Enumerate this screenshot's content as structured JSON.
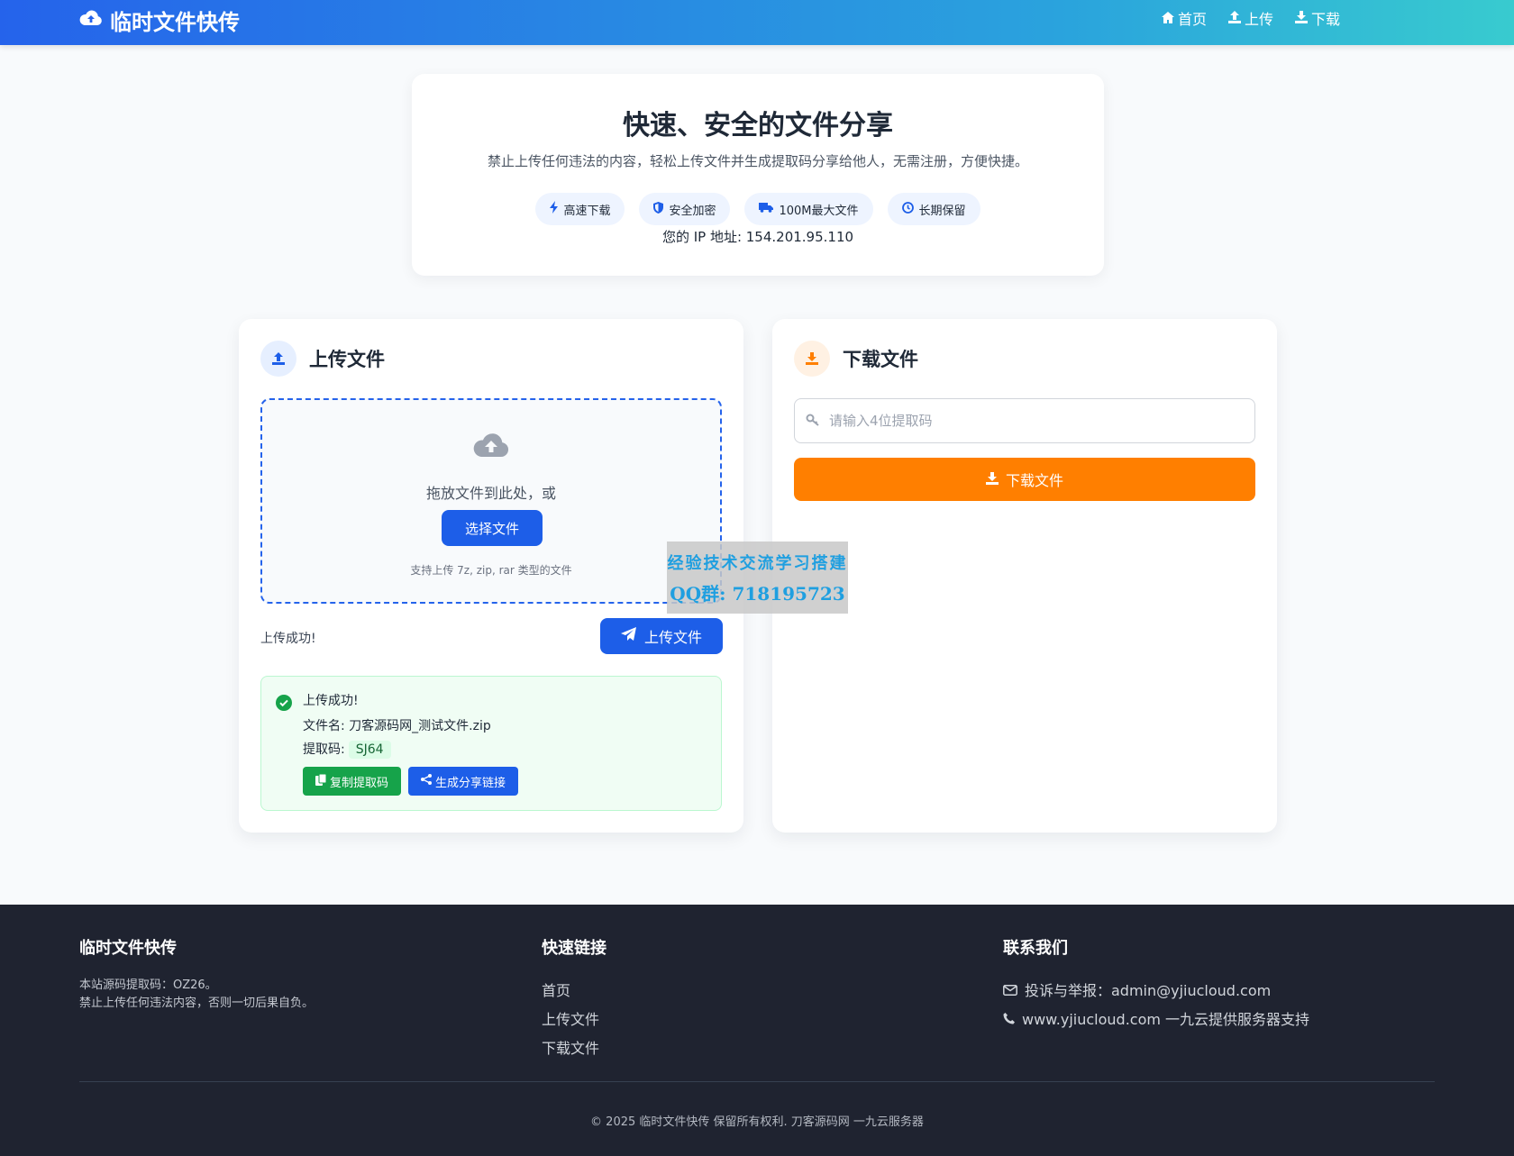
{
  "header": {
    "brand": "临时文件快传",
    "nav": [
      {
        "label": "首页",
        "icon": "home-icon"
      },
      {
        "label": "上传",
        "icon": "upload-icon"
      },
      {
        "label": "下载",
        "icon": "download-icon"
      }
    ]
  },
  "hero": {
    "title": "快速、安全的文件分享",
    "description": "禁止上传任何违法的内容，轻松上传文件并生成提取码分享给他人，无需注册，方便快捷。",
    "features": [
      {
        "label": "高速下载",
        "icon": "bolt-icon"
      },
      {
        "label": "安全加密",
        "icon": "shield-icon"
      },
      {
        "label": "100M最大文件",
        "icon": "truck-icon"
      },
      {
        "label": "长期保留",
        "icon": "clock-icon"
      }
    ],
    "ip_text": "您的 IP 地址: 154.201.95.110"
  },
  "upload": {
    "title": "上传文件",
    "drop_text": "拖放文件到此处，或",
    "choose_button": "选择文件",
    "hint": "支持上传 7z, zip, rar 类型的文件",
    "status": "上传成功!",
    "upload_button": "上传文件",
    "result": {
      "heading": "上传成功!",
      "filename_label": "文件名: 刀客源码网_测试文件.zip",
      "code_label": "提取码:",
      "code_value": "SJ64",
      "copy_button": "复制提取码",
      "share_button": "生成分享链接"
    }
  },
  "download": {
    "title": "下载文件",
    "input_placeholder": "请输入4位提取码",
    "input_value": "",
    "download_button": "下载文件"
  },
  "watermark": {
    "line1": "经验技术交流学习搭建",
    "line2": "QQ群: 718195723"
  },
  "footer": {
    "col1": {
      "heading": "临时文件快传",
      "line1": "本站源码提取码：OZ26。",
      "line2": "禁止上传任何违法内容，否则一切后果自负。"
    },
    "col2": {
      "heading": "快速链接",
      "links": [
        "首页",
        "上传文件",
        "下载文件"
      ]
    },
    "col3": {
      "heading": "联系我们",
      "email": "投诉与举报：admin@yjiucloud.com",
      "site": "www.yjiucloud.com 一九云提供服务器支持"
    },
    "copyright": "© 2025 临时文件快传 保留所有权利. 刀客源码网  一九云服务器"
  },
  "colors": {
    "primary": "#1d5ee8",
    "orange": "#ff7f00",
    "green": "#16a34a",
    "footer_bg": "#1f2330"
  }
}
